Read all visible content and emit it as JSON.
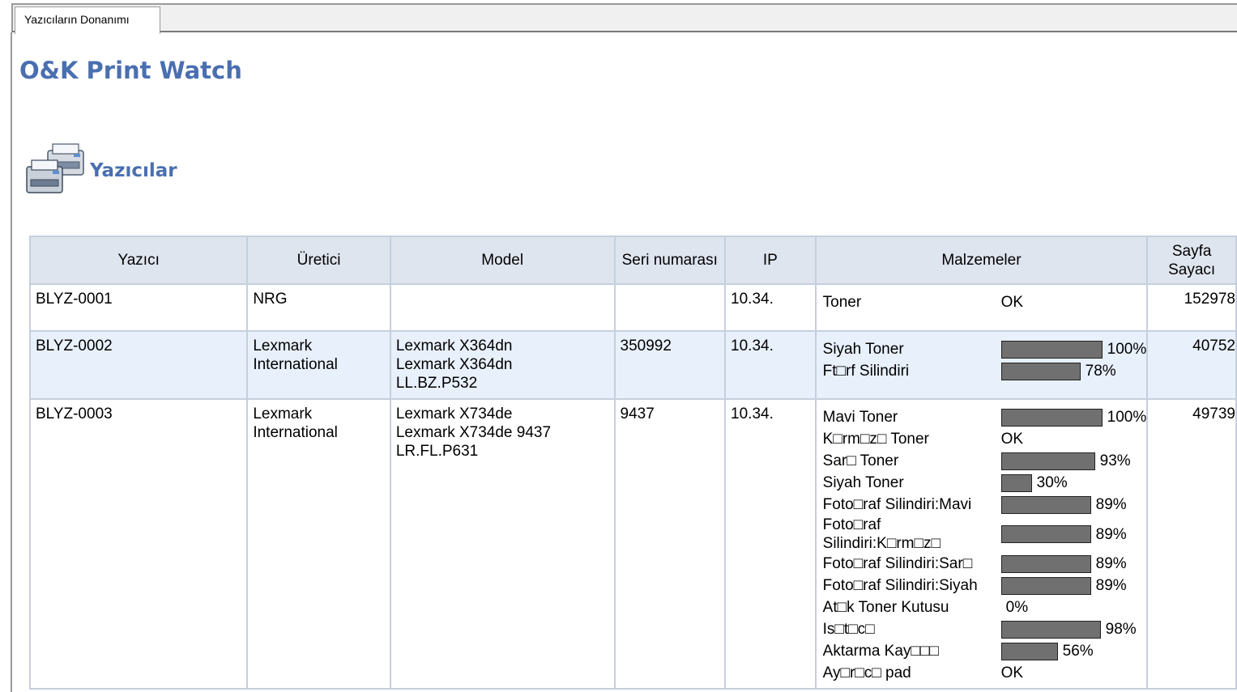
{
  "tab": {
    "label": "Yazıcıların Donanımı"
  },
  "app_title": "O&K Print Watch",
  "section_title": "Yazıcılar",
  "icons": {
    "section": "printers-icon"
  },
  "colors": {
    "title": "#4a6fb0",
    "header_bg": "#dfe5ef",
    "alt_row_bg": "#e8f0fb",
    "bar_fill": "#707070"
  },
  "table": {
    "headers": [
      "Yazıcı",
      "Üretici",
      "Model",
      "Seri numarası",
      "IP",
      "Malzemeler",
      "Sayfa Sayacı"
    ],
    "rows": [
      {
        "printer": "BLYZ-0001",
        "maker": "NRG",
        "model": [],
        "serial": "",
        "ip": "10.34.",
        "supplies": [
          {
            "name": "Toner",
            "status": "OK"
          }
        ],
        "counter": "152978"
      },
      {
        "printer": "BLYZ-0002",
        "maker": "Lexmark International",
        "model": [
          "Lexmark X364dn",
          "Lexmark X364dn",
          "LL.BZ.P532"
        ],
        "serial": "350992",
        "ip": "10.34.",
        "supplies": [
          {
            "name": "Siyah Toner",
            "level": 100,
            "label": "100%"
          },
          {
            "name": "Ft□rf Silindiri",
            "level": 78,
            "label": "78%"
          }
        ],
        "counter": "40752"
      },
      {
        "printer": "BLYZ-0003",
        "maker": "Lexmark International",
        "model": [
          "Lexmark X734de",
          "Lexmark X734de 9437",
          "LR.FL.P631"
        ],
        "serial": "9437",
        "ip": "10.34.",
        "supplies": [
          {
            "name": "Mavi Toner",
            "level": 100,
            "label": "100%"
          },
          {
            "name": "K□rm□z□ Toner",
            "status": "OK"
          },
          {
            "name": "Sar□ Toner",
            "level": 93,
            "label": "93%"
          },
          {
            "name": "Siyah Toner",
            "level": 30,
            "label": "30%"
          },
          {
            "name": "Foto□raf Silindiri:Mavi",
            "level": 89,
            "label": "89%"
          },
          {
            "name": "Foto□raf Silindiri:K□rm□z□",
            "level": 89,
            "label": "89%"
          },
          {
            "name": "Foto□raf Silindiri:Sar□",
            "level": 89,
            "label": "89%"
          },
          {
            "name": "Foto□raf Silindiri:Siyah",
            "level": 89,
            "label": "89%"
          },
          {
            "name": "At□k Toner Kutusu",
            "level": 0,
            "label": "0%"
          },
          {
            "name": "Is□t□c□",
            "level": 98,
            "label": "98%"
          },
          {
            "name": "Aktarma Kay□□□",
            "level": 56,
            "label": "56%"
          },
          {
            "name": "Ay□r□c□ pad",
            "status": "OK"
          }
        ],
        "counter": "49739"
      }
    ]
  }
}
